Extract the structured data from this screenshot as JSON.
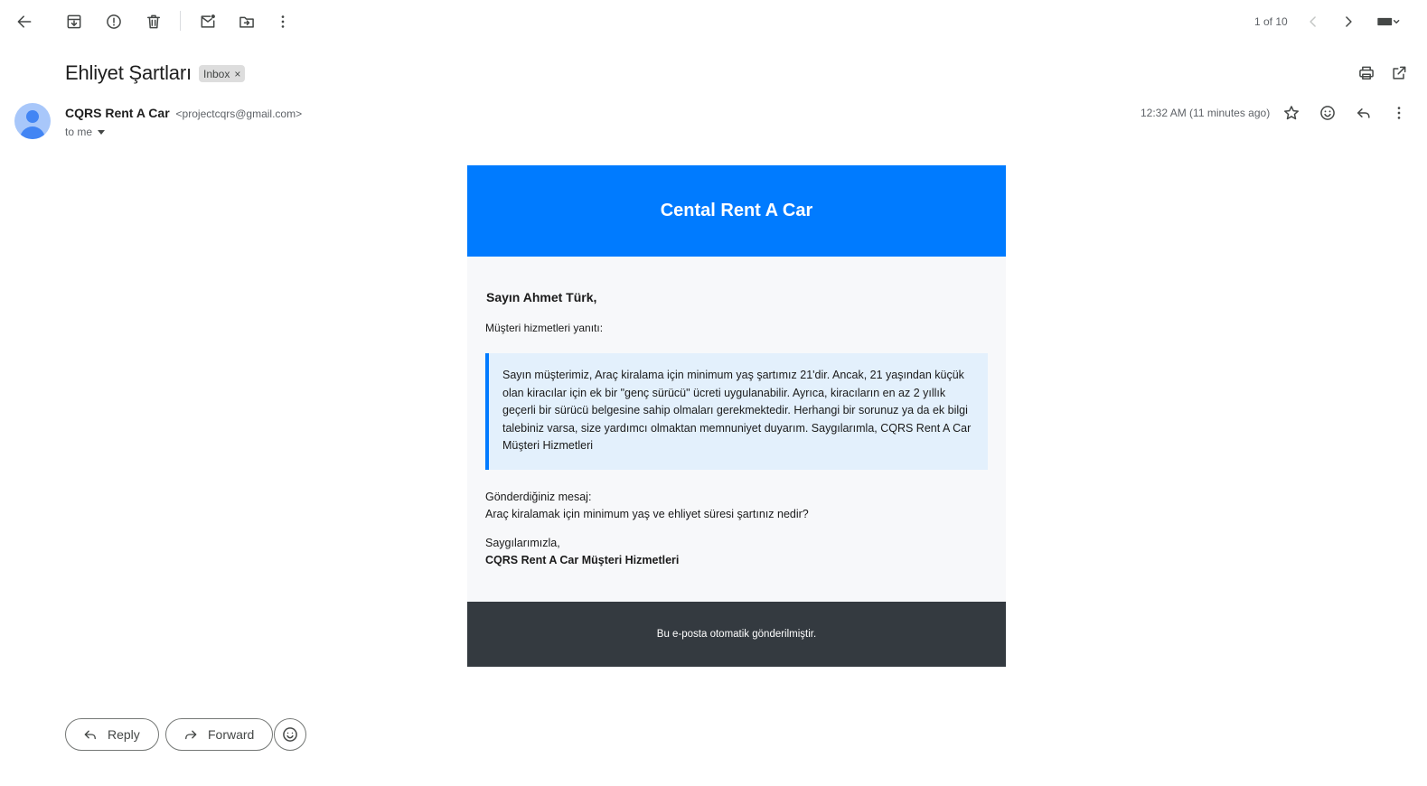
{
  "toolbar": {
    "back_icon": "arrow-back-icon",
    "archive_icon": "archive-icon",
    "spam_icon": "report-spam-icon",
    "delete_icon": "trash-icon",
    "mark_unread_icon": "mark-unread-icon",
    "move_icon": "move-to-folder-icon",
    "more_icon": "more-vertical-icon",
    "pager_text": "1 of 10",
    "input_tools_icon": "keyboard-icon"
  },
  "thread": {
    "subject": "Ehliyet Şartları",
    "label": "Inbox",
    "label_remove": "×",
    "print_icon": "print-icon",
    "open_new_window_icon": "open-in-new-icon"
  },
  "message": {
    "sender_name": "CQRS Rent A Car",
    "sender_email": "<projectcqrs@gmail.com>",
    "recipient": "to me",
    "timestamp": "12:32 AM (11 minutes ago)"
  },
  "email": {
    "header_title": "Cental Rent A Car",
    "greeting": "Sayın Ahmet Türk,",
    "intro": "Müşteri hizmetleri yanıtı:",
    "reply_text": "Sayın müşterimiz, Araç kiralama için minimum yaş şartımız 21'dir. Ancak, 21 yaşından küçük olan kiracılar için ek bir \"genç sürücü\" ücreti uygulanabilir. Ayrıca, kiracıların en az 2 yıllık geçerli bir sürücü belgesine sahip olmaları gerekmektedir. Herhangi bir sorunuz ya da ek bilgi talebiniz varsa, size yardımcı olmaktan memnuniyet duyarım. Saygılarımla, CQRS Rent A Car Müşteri Hizmetleri",
    "sent_label": "Gönderdiğiniz mesaj:",
    "sent_text": "Araç kiralamak için minimum yaş ve ehliyet süresi şartınız nedir?",
    "sign_off": "Saygılarımızla,",
    "sign_name": "CQRS Rent A Car Müşteri Hizmetleri",
    "footer": "Bu e-posta otomatik gönderilmiştir."
  },
  "actions": {
    "reply_label": "Reply",
    "forward_label": "Forward"
  },
  "colors": {
    "email_header": "#007bff",
    "email_footer": "#343a40",
    "quote_bg": "#e3f0fc",
    "avatar_bg": "#a8c7fa"
  }
}
